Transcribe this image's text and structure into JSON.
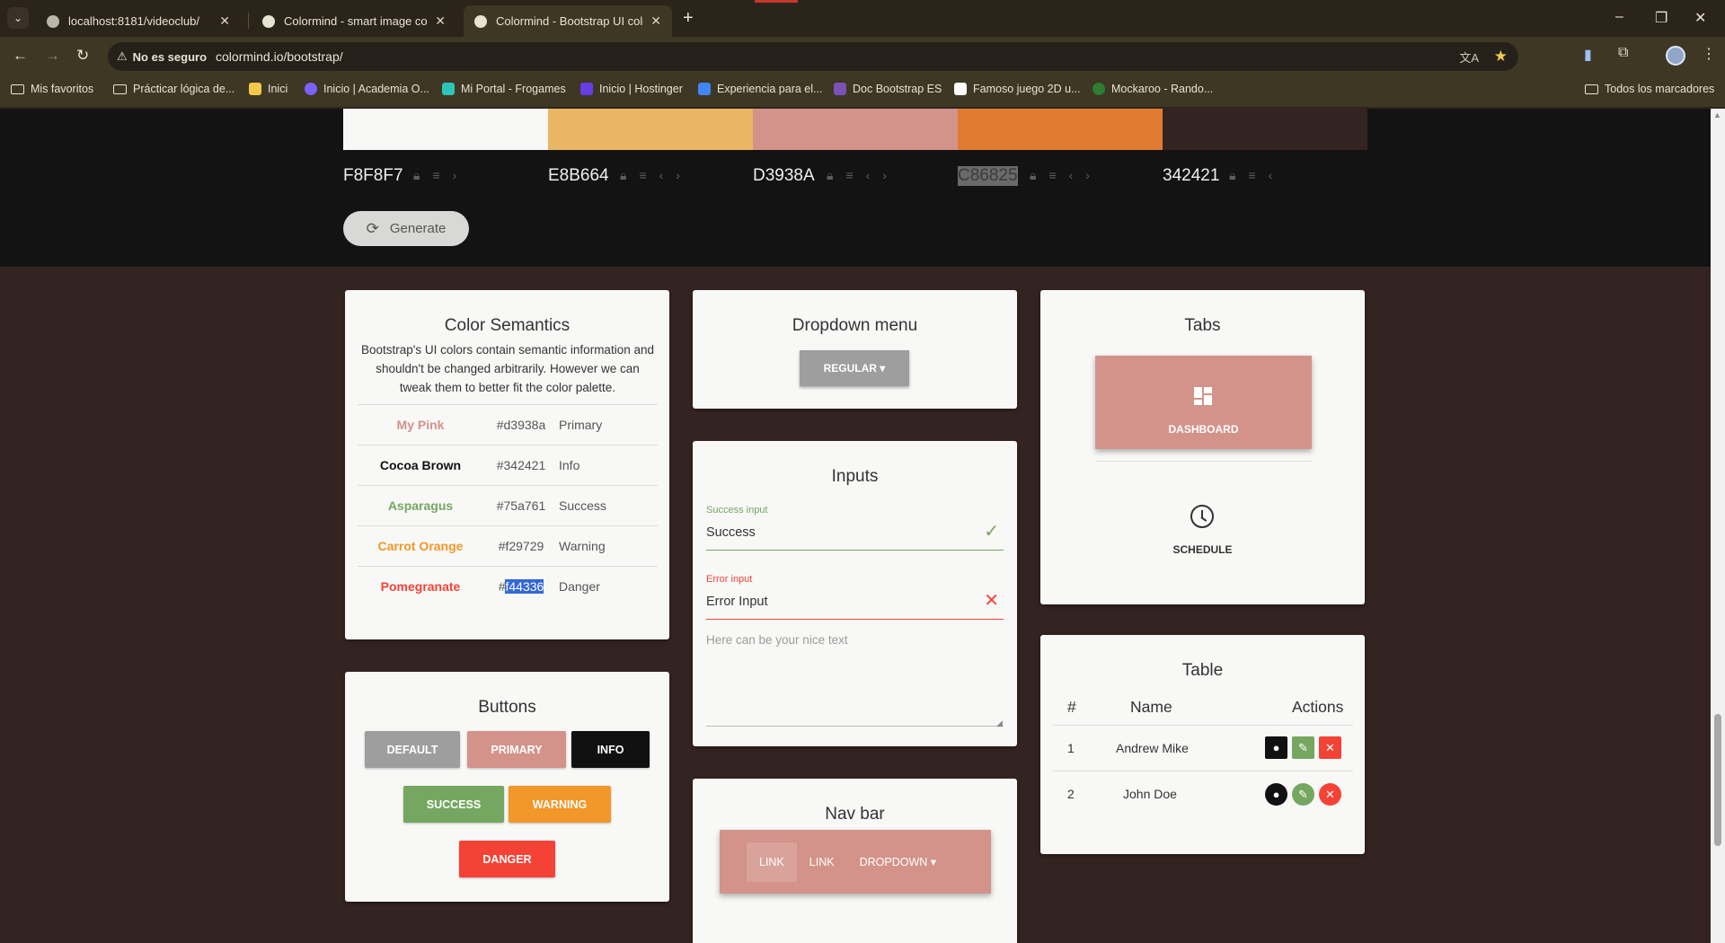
{
  "browser": {
    "tabs": [
      {
        "title": "localhost:8181/videoclub/",
        "active": false
      },
      {
        "title": "Colormind - smart image color",
        "active": false
      },
      {
        "title": "Colormind - Bootstrap UI color",
        "active": true
      }
    ],
    "security_label": "No es seguro",
    "url": "colormind.io/bootstrap/",
    "bookmarks": [
      "Mis favoritos",
      "Prácticar lógica de...",
      "Inici",
      "Inicio | Academia O...",
      "Mi Portal - Frogames",
      "Inicio | Hostinger",
      "Experiencia para el...",
      "Doc Bootstrap ES",
      "Famoso juego 2D u...",
      "Mockaroo - Rando..."
    ],
    "all_bookmarks": "Todos los marcadores"
  },
  "palette": {
    "colors": [
      {
        "hex": "F8F8F7",
        "color": "#f8f8f7"
      },
      {
        "hex": "E8B664",
        "color": "#e8b664"
      },
      {
        "hex": "D3938A",
        "color": "#d3938a"
      },
      {
        "hex": "C86825",
        "color": "#e07a30"
      },
      {
        "hex": "342421",
        "color": "#342421"
      }
    ],
    "generate_label": "Generate"
  },
  "semantics": {
    "title": "Color Semantics",
    "description": "Bootstrap's UI colors contain semantic information and shouldn't be changed arbitrarily. However we can tweak them to better fit the color palette.",
    "rows": [
      {
        "name": "My Pink",
        "hex": "#d3938a",
        "role": "Primary",
        "color": "#d3938a"
      },
      {
        "name": "Cocoa Brown",
        "hex": "#342421",
        "role": "Info",
        "color": "#111111"
      },
      {
        "name": "Asparagus",
        "hex": "#75a761",
        "role": "Success",
        "color": "#75a761"
      },
      {
        "name": "Carrot Orange",
        "hex": "#f29729",
        "role": "Warning",
        "color": "#f29729"
      },
      {
        "name": "Pomegranate",
        "hex_prefix": "#",
        "hex_selected": "f44336",
        "role": "Danger",
        "color": "#f44336"
      }
    ]
  },
  "buttons": {
    "title": "Buttons",
    "default": "DEFAULT",
    "primary": "PRIMARY",
    "info": "INFO",
    "success": "SUCCESS",
    "warning": "WARNING",
    "danger": "DANGER"
  },
  "dropdown": {
    "title": "Dropdown menu",
    "button_label": "REGULAR ▾"
  },
  "inputs": {
    "title": "Inputs",
    "success_label": "Success input",
    "success_value": "Success",
    "error_label": "Error input",
    "error_value": "Error Input",
    "textarea_placeholder": "Here can be your nice text"
  },
  "navbar": {
    "title": "Nav bar",
    "links": [
      "LINK",
      "LINK",
      "DROPDOWN ▾"
    ]
  },
  "tabs": {
    "title": "Tabs",
    "items": [
      "DASHBOARD",
      "SCHEDULE"
    ]
  },
  "table": {
    "title": "Table",
    "headers": [
      "#",
      "Name",
      "Actions"
    ],
    "rows": [
      {
        "id": "1",
        "name": "Andrew Mike"
      },
      {
        "id": "2",
        "name": "John Doe"
      }
    ]
  }
}
